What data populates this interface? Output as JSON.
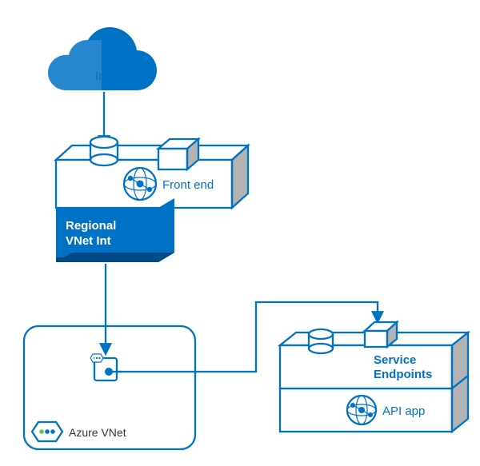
{
  "diagram": {
    "internet": {
      "label": "Internet"
    },
    "frontend": {
      "label": "Front end",
      "vnet_int_line1": "Regional",
      "vnet_int_line2": "VNet Int"
    },
    "vnet": {
      "label": "Azure VNet"
    },
    "api": {
      "label": "API app",
      "endpoints_line1": "Service",
      "endpoints_line2": "Endpoints"
    }
  },
  "colors": {
    "brand": "#0072c6",
    "grey": "#b3b3b3"
  }
}
